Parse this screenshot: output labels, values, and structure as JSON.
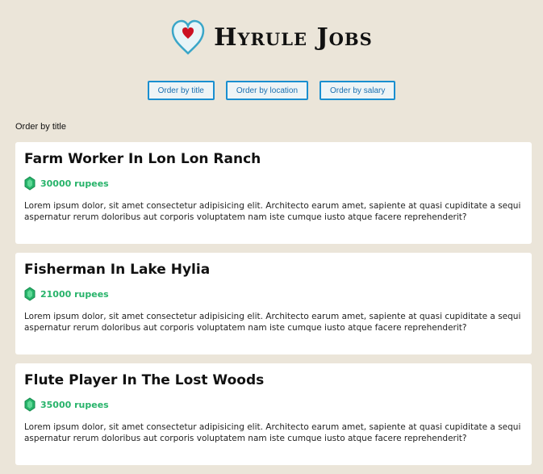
{
  "header": {
    "title": "Hyrule Jobs",
    "logo_icon": "heart-container-icon"
  },
  "sort_buttons": [
    {
      "label": "Order by title"
    },
    {
      "label": "Order by location"
    },
    {
      "label": "Order by salary"
    }
  ],
  "order_label": "Order by title",
  "colors": {
    "background": "#ebe5d9",
    "button_border": "#1a8fd0",
    "salary_green": "#27b36a",
    "heart_red": "#cc1122",
    "heart_outline": "#3aa6c8"
  },
  "jobs": [
    {
      "title": "Farm Worker In Lon Lon Ranch",
      "salary": "30000 rupees",
      "description": "Lorem ipsum dolor, sit amet consectetur adipisicing elit. Architecto earum amet, sapiente at quasi cupiditate a sequi aspernatur rerum doloribus aut corporis voluptatem nam iste cumque iusto atque facere reprehenderit?"
    },
    {
      "title": "Fisherman In Lake Hylia",
      "salary": "21000 rupees",
      "description": "Lorem ipsum dolor, sit amet consectetur adipisicing elit. Architecto earum amet, sapiente at quasi cupiditate a sequi aspernatur rerum doloribus aut corporis voluptatem nam iste cumque iusto atque facere reprehenderit?"
    },
    {
      "title": "Flute Player In The Lost Woods",
      "salary": "35000 rupees",
      "description": "Lorem ipsum dolor, sit amet consectetur adipisicing elit. Architecto earum amet, sapiente at quasi cupiditate a sequi aspernatur rerum doloribus aut corporis voluptatem nam iste cumque iusto atque facere reprehenderit?"
    }
  ]
}
